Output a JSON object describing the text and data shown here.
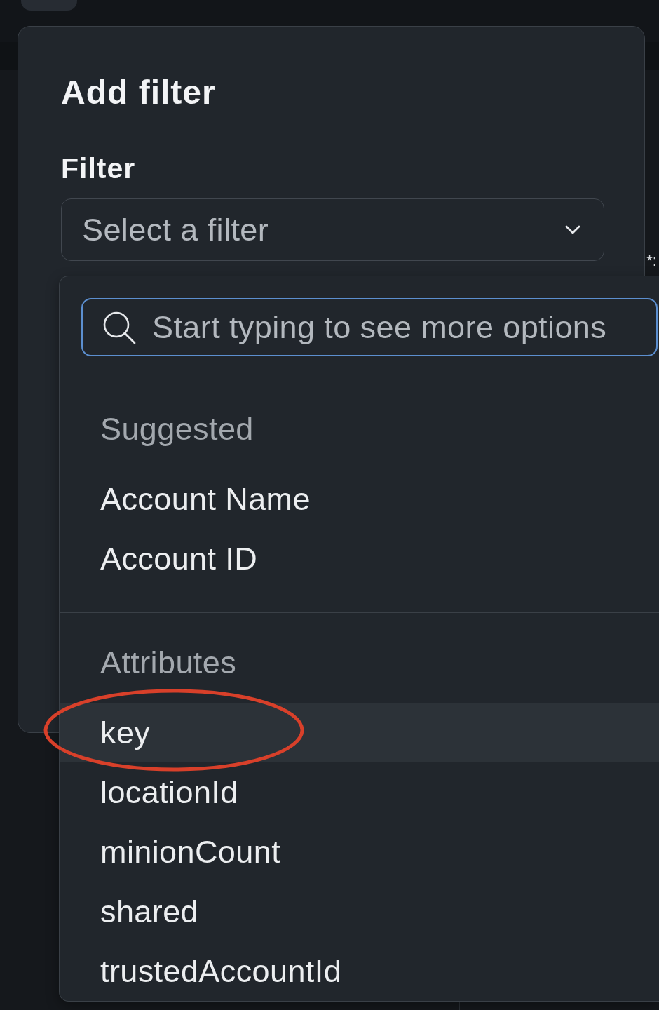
{
  "page_behind": {
    "cut_text": "*:"
  },
  "dialog": {
    "title": "Add filter",
    "field_label": "Filter",
    "select": {
      "placeholder": "Select a filter"
    }
  },
  "dropdown": {
    "search": {
      "placeholder": "Start typing to see more options",
      "focused": true
    },
    "sections": [
      {
        "heading": "Suggested",
        "options": [
          {
            "label": "Account Name",
            "selected": false,
            "circled": false
          },
          {
            "label": "Account ID",
            "selected": false,
            "circled": false
          }
        ]
      },
      {
        "heading": "Attributes",
        "options": [
          {
            "label": "key",
            "selected": true,
            "circled": true
          },
          {
            "label": "locationId",
            "selected": false,
            "circled": false
          },
          {
            "label": "minionCount",
            "selected": false,
            "circled": false
          },
          {
            "label": "shared",
            "selected": false,
            "circled": false
          },
          {
            "label": "trustedAccountId",
            "selected": false,
            "circled": false
          }
        ]
      }
    ]
  }
}
